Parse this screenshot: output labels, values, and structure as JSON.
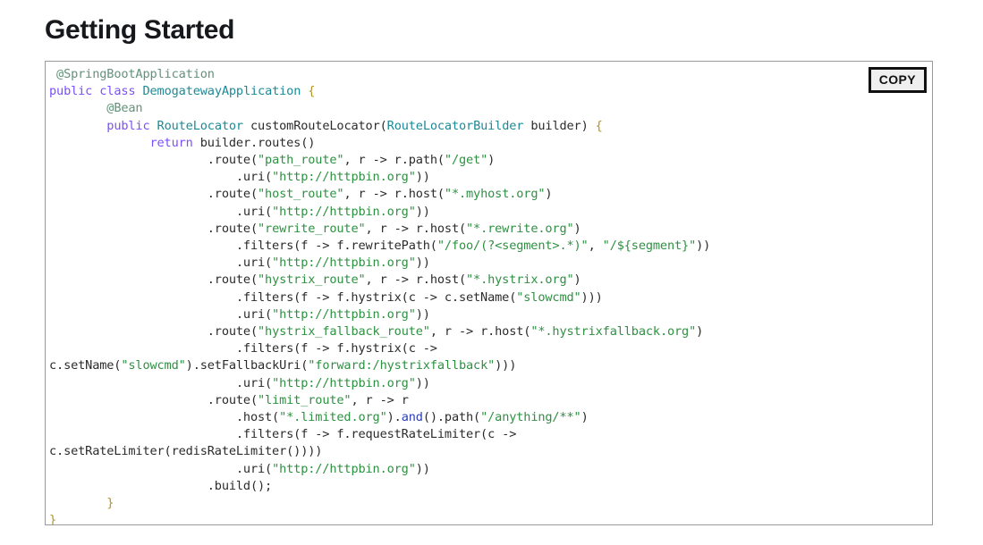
{
  "page": {
    "title": "Getting Started"
  },
  "code_panel": {
    "copy_label": "COPY",
    "language": "java",
    "colors": {
      "annotation": "#62927a",
      "keyword": "#7c4dff",
      "type": "#1b8a96",
      "string": "#2e9142",
      "method_blue": "#2a3fb8",
      "brace": "#b39527",
      "plain": "#2b2b2b",
      "panel_border": "#9a9a9a",
      "copy_border": "#111111",
      "copy_background": "#efefef"
    },
    "lines": [
      {
        "indent": 1,
        "tokens": [
          {
            "t": "ann",
            "v": "@SpringBootApplication"
          }
        ]
      },
      {
        "indent": 0,
        "tokens": [
          {
            "t": "kw",
            "v": "public"
          },
          {
            "t": "plain",
            "v": " "
          },
          {
            "t": "kw",
            "v": "class"
          },
          {
            "t": "plain",
            "v": " "
          },
          {
            "t": "type",
            "v": "DemogatewayApplication"
          },
          {
            "t": "plain",
            "v": " "
          },
          {
            "t": "brace",
            "v": "{"
          }
        ]
      },
      {
        "indent": 8,
        "tokens": [
          {
            "t": "ann",
            "v": "@Bean"
          }
        ]
      },
      {
        "indent": 8,
        "tokens": [
          {
            "t": "kw",
            "v": "public"
          },
          {
            "t": "plain",
            "v": " "
          },
          {
            "t": "type",
            "v": "RouteLocator"
          },
          {
            "t": "plain",
            "v": " customRouteLocator("
          },
          {
            "t": "type",
            "v": "RouteLocatorBuilder"
          },
          {
            "t": "plain",
            "v": " builder) "
          },
          {
            "t": "brace",
            "v": "{"
          }
        ]
      },
      {
        "indent": 14,
        "tokens": [
          {
            "t": "kw",
            "v": "return"
          },
          {
            "t": "plain",
            "v": " builder.routes()"
          }
        ]
      },
      {
        "indent": 22,
        "tokens": [
          {
            "t": "plain",
            "v": ".route("
          },
          {
            "t": "str",
            "v": "\"path_route\""
          },
          {
            "t": "plain",
            "v": ", r -> r.path("
          },
          {
            "t": "str",
            "v": "\"/get\""
          },
          {
            "t": "plain",
            "v": ")"
          }
        ]
      },
      {
        "indent": 26,
        "tokens": [
          {
            "t": "plain",
            "v": ".uri("
          },
          {
            "t": "str",
            "v": "\"http://httpbin.org\""
          },
          {
            "t": "plain",
            "v": "))"
          }
        ]
      },
      {
        "indent": 22,
        "tokens": [
          {
            "t": "plain",
            "v": ".route("
          },
          {
            "t": "str",
            "v": "\"host_route\""
          },
          {
            "t": "plain",
            "v": ", r -> r.host("
          },
          {
            "t": "str",
            "v": "\"*.myhost.org\""
          },
          {
            "t": "plain",
            "v": ")"
          }
        ]
      },
      {
        "indent": 26,
        "tokens": [
          {
            "t": "plain",
            "v": ".uri("
          },
          {
            "t": "str",
            "v": "\"http://httpbin.org\""
          },
          {
            "t": "plain",
            "v": "))"
          }
        ]
      },
      {
        "indent": 22,
        "tokens": [
          {
            "t": "plain",
            "v": ".route("
          },
          {
            "t": "str",
            "v": "\"rewrite_route\""
          },
          {
            "t": "plain",
            "v": ", r -> r.host("
          },
          {
            "t": "str",
            "v": "\"*.rewrite.org\""
          },
          {
            "t": "plain",
            "v": ")"
          }
        ]
      },
      {
        "indent": 26,
        "tokens": [
          {
            "t": "plain",
            "v": ".filters(f -> f.rewritePath("
          },
          {
            "t": "str",
            "v": "\"/foo/(?<segment>.*)\""
          },
          {
            "t": "plain",
            "v": ", "
          },
          {
            "t": "str",
            "v": "\"/${segment}\""
          },
          {
            "t": "plain",
            "v": "))"
          }
        ]
      },
      {
        "indent": 26,
        "tokens": [
          {
            "t": "plain",
            "v": ".uri("
          },
          {
            "t": "str",
            "v": "\"http://httpbin.org\""
          },
          {
            "t": "plain",
            "v": "))"
          }
        ]
      },
      {
        "indent": 22,
        "tokens": [
          {
            "t": "plain",
            "v": ".route("
          },
          {
            "t": "str",
            "v": "\"hystrix_route\""
          },
          {
            "t": "plain",
            "v": ", r -> r.host("
          },
          {
            "t": "str",
            "v": "\"*.hystrix.org\""
          },
          {
            "t": "plain",
            "v": ")"
          }
        ]
      },
      {
        "indent": 26,
        "tokens": [
          {
            "t": "plain",
            "v": ".filters(f -> f.hystrix(c -> c.setName("
          },
          {
            "t": "str",
            "v": "\"slowcmd\""
          },
          {
            "t": "plain",
            "v": ")))"
          }
        ]
      },
      {
        "indent": 26,
        "tokens": [
          {
            "t": "plain",
            "v": ".uri("
          },
          {
            "t": "str",
            "v": "\"http://httpbin.org\""
          },
          {
            "t": "plain",
            "v": "))"
          }
        ]
      },
      {
        "indent": 22,
        "tokens": [
          {
            "t": "plain",
            "v": ".route("
          },
          {
            "t": "str",
            "v": "\"hystrix_fallback_route\""
          },
          {
            "t": "plain",
            "v": ", r -> r.host("
          },
          {
            "t": "str",
            "v": "\"*.hystrixfallback.org\""
          },
          {
            "t": "plain",
            "v": ")"
          }
        ]
      },
      {
        "indent": 26,
        "tokens": [
          {
            "t": "plain",
            "v": ".filters(f -> f.hystrix(c ->"
          }
        ]
      },
      {
        "indent": 0,
        "tokens": [
          {
            "t": "plain",
            "v": "c.setName("
          },
          {
            "t": "str",
            "v": "\"slowcmd\""
          },
          {
            "t": "plain",
            "v": ").setFallbackUri("
          },
          {
            "t": "str",
            "v": "\"forward:/hystrixfallback\""
          },
          {
            "t": "plain",
            "v": ")))"
          }
        ]
      },
      {
        "indent": 26,
        "tokens": [
          {
            "t": "plain",
            "v": ".uri("
          },
          {
            "t": "str",
            "v": "\"http://httpbin.org\""
          },
          {
            "t": "plain",
            "v": "))"
          }
        ]
      },
      {
        "indent": 22,
        "tokens": [
          {
            "t": "plain",
            "v": ".route("
          },
          {
            "t": "str",
            "v": "\"limit_route\""
          },
          {
            "t": "plain",
            "v": ", r -> r"
          }
        ]
      },
      {
        "indent": 26,
        "tokens": [
          {
            "t": "plain",
            "v": ".host("
          },
          {
            "t": "str",
            "v": "\"*.limited.org\""
          },
          {
            "t": "plain",
            "v": ")."
          },
          {
            "t": "blue",
            "v": "and"
          },
          {
            "t": "plain",
            "v": "().path("
          },
          {
            "t": "str",
            "v": "\"/anything/**\""
          },
          {
            "t": "plain",
            "v": ")"
          }
        ]
      },
      {
        "indent": 26,
        "tokens": [
          {
            "t": "plain",
            "v": ".filters(f -> f.requestRateLimiter(c ->"
          }
        ]
      },
      {
        "indent": 0,
        "tokens": [
          {
            "t": "plain",
            "v": "c.setRateLimiter(redisRateLimiter())))"
          }
        ]
      },
      {
        "indent": 26,
        "tokens": [
          {
            "t": "plain",
            "v": ".uri("
          },
          {
            "t": "str",
            "v": "\"http://httpbin.org\""
          },
          {
            "t": "plain",
            "v": "))"
          }
        ]
      },
      {
        "indent": 22,
        "tokens": [
          {
            "t": "plain",
            "v": ".build();"
          }
        ]
      },
      {
        "indent": 8,
        "tokens": [
          {
            "t": "brace",
            "v": "}"
          }
        ]
      },
      {
        "indent": 0,
        "tokens": [
          {
            "t": "brace",
            "v": "}"
          }
        ]
      }
    ]
  }
}
